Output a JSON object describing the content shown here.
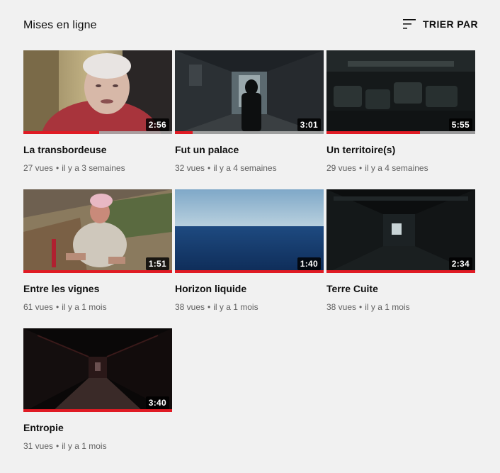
{
  "page": {
    "title": "Mises en ligne",
    "sort_label": "TRIER PAR"
  },
  "colors": {
    "background": "#f1f1f1",
    "progress_red": "#e01b24",
    "meta_gray": "#606060"
  },
  "videos": [
    {
      "title": "La transbordeuse",
      "views": "27 vues",
      "age": "il y a 3 semaines",
      "duration": "2:56",
      "progress": 0.51,
      "thumb": "elderly-woman-portrait"
    },
    {
      "title": "Fut un palace",
      "views": "32 vues",
      "age": "il y a 4 semaines",
      "duration": "3:01",
      "progress": 0.12,
      "thumb": "dark-corridor-silhouette"
    },
    {
      "title": "Un territoire(s)",
      "views": "29 vues",
      "age": "il y a 4 semaines",
      "duration": "5:55",
      "progress": 0.63,
      "thumb": "dark-theater-seats"
    },
    {
      "title": "Entre les vignes",
      "views": "61 vues",
      "age": "il y a 1 mois",
      "duration": "1:51",
      "progress": 1.0,
      "thumb": "vineyard-worker"
    },
    {
      "title": "Horizon liquide",
      "views": "38 vues",
      "age": "il y a 1 mois",
      "duration": "1:40",
      "progress": 1.0,
      "thumb": "ocean-horizon"
    },
    {
      "title": "Terre Cuite",
      "views": "38 vues",
      "age": "il y a 1 mois",
      "duration": "2:34",
      "progress": 1.0,
      "thumb": "dark-factory-hall"
    },
    {
      "title": "Entropie",
      "views": "31 vues",
      "age": "il y a 1 mois",
      "duration": "3:40",
      "progress": 1.0,
      "thumb": "dark-bridge-tunnel"
    }
  ]
}
